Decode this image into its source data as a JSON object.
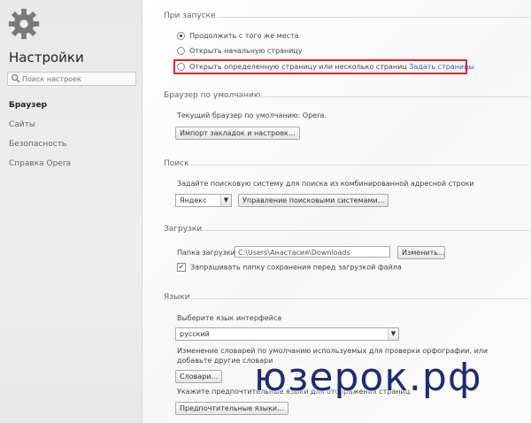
{
  "sidebar": {
    "title": "Настройки",
    "search_placeholder": "Поиск настроек",
    "items": [
      {
        "label": "Браузер"
      },
      {
        "label": "Сайты"
      },
      {
        "label": "Безопасность"
      },
      {
        "label": "Справка Opera"
      }
    ]
  },
  "startup": {
    "title": "При запуске",
    "options": [
      {
        "label": "Продолжить с того же места",
        "selected": true
      },
      {
        "label": "Открыть начальную страницу",
        "selected": false
      },
      {
        "label": "Открыть определенную страницу или несколько страниц",
        "selected": false
      }
    ],
    "link": "Задать страницы"
  },
  "default_browser": {
    "title": "Браузер по умолчанию",
    "text": "Текущий браузер по умолчанию: Opera.",
    "button": "Импорт закладок и настроек..."
  },
  "search": {
    "title": "Поиск",
    "text": "Задайте поисковую систему для поиска из комбинированной адресной строки",
    "engine": "Яндекс",
    "manage_button": "Управление поисковыми системами..."
  },
  "downloads": {
    "title": "Загрузки",
    "folder_label": "Папка загрузки:",
    "folder_value": "C:\\Users\\Анастасия\\Downloads",
    "change_button": "Изменить...",
    "ask_label": "Запрашивать папку сохранения перед загрузкой файла",
    "ask_checked": true
  },
  "languages": {
    "title": "Языки",
    "ui_label": "Выберите язык интерфейса",
    "ui_value": "русский",
    "dict_text": "Изменение словарей по умолчанию используемых для проверки орфографии, или добавьте другие словари",
    "dict_button": "Словари...",
    "pref_text": "Укажите предпочтительные языки для отображения страниц",
    "pref_button": "Предпочтительные языки..."
  },
  "watermark": "юзерок.рф",
  "colors": {
    "highlight": "#e0242f",
    "link": "#3366aa",
    "watermark": "#1f2a7a"
  }
}
